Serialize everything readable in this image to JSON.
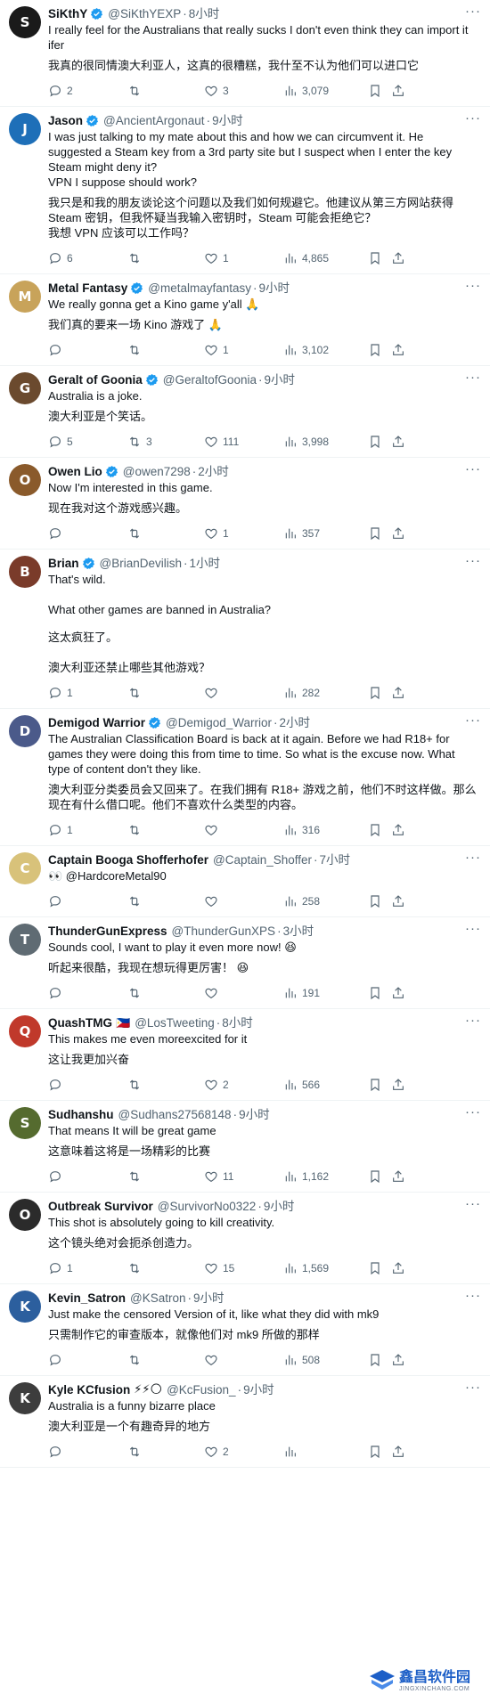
{
  "tweets": [
    {
      "name": "SiKthY",
      "verified": true,
      "handle": "@SiKthYEXP",
      "time": "8小时",
      "avatar_color": "#1a1a1a",
      "text": [
        "I really feel for the Australians that really sucks I don't even think they can import it ifer",
        "我真的很同情澳大利亚人，这真的很糟糕，我什至不认为他们可以进口它"
      ],
      "replies": "2",
      "retweets": "",
      "likes": "3",
      "views": "3,079"
    },
    {
      "name": "Jason",
      "verified": true,
      "handle": "@AncientArgonaut",
      "time": "9小时",
      "avatar_color": "#1e6fb8",
      "text": [
        "I was just talking to my mate about this and how we can circumvent it. He suggested a Steam key from a 3rd party site but I suspect when I enter the key Steam might deny it?\nVPN I suppose should work?",
        "我只是和我的朋友谈论这个问题以及我们如何规避它。他建议从第三方网站获得 Steam 密钥，但我怀疑当我输入密钥时，Steam 可能会拒绝它？\n我想 VPN 应该可以工作吗？"
      ],
      "replies": "6",
      "retweets": "",
      "likes": "1",
      "views": "4,865"
    },
    {
      "name": "Metal Fantasy",
      "verified": true,
      "handle": "@metalmayfantasy",
      "time": "9小时",
      "avatar_color": "#c8a35a",
      "text": [
        "We really gonna get a Kino game y'all 🙏",
        "我们真的要来一场 Kino 游戏了 🙏"
      ],
      "replies": "",
      "retweets": "",
      "likes": "1",
      "views": "3,102"
    },
    {
      "name": "Geralt of Goonia",
      "verified": true,
      "handle": "@GeraltofGoonia",
      "time": "9小时",
      "avatar_color": "#6b4a2e",
      "text": [
        "Australia is a joke.",
        "澳大利亚是个笑话。"
      ],
      "replies": "5",
      "retweets": "3",
      "likes": "111",
      "views": "3,998"
    },
    {
      "name": "Owen Lio",
      "verified": true,
      "handle": "@owen7298",
      "time": "2小时",
      "avatar_color": "#8a5a2b",
      "text": [
        "Now I'm interested in this game.",
        "现在我对这个游戏感兴趣。"
      ],
      "replies": "",
      "retweets": "",
      "likes": "1",
      "views": "357"
    },
    {
      "name": "Brian",
      "verified": true,
      "handle": "@BrianDevilish",
      "time": "1小时",
      "avatar_color": "#7a3b2a",
      "text": [
        "That's wild.\n\nWhat other games are banned in Australia?",
        "这太疯狂了。\n\n澳大利亚还禁止哪些其他游戏？"
      ],
      "replies": "1",
      "retweets": "",
      "likes": "",
      "views": "282"
    },
    {
      "name": "Demigod Warrior",
      "verified": true,
      "handle": "@Demigod_Warrior",
      "time": "2小时",
      "avatar_color": "#4b5a8a",
      "text": [
        "The Australian Classification Board is back at it again. Before we had R18+ for games they were doing this from time to time. So what is the excuse now. What type of content don't they like.",
        "澳大利亚分类委员会又回来了。在我们拥有 R18+ 游戏之前，他们不时这样做。那么现在有什么借口呢。他们不喜欢什么类型的内容。"
      ],
      "replies": "1",
      "retweets": "",
      "likes": "",
      "views": "316"
    },
    {
      "name": "Captain Booga Shofferhofer",
      "verified": false,
      "handle": "@Captain_Shoffer",
      "time": "7小时",
      "avatar_color": "#d8c27a",
      "text": [
        "👀 @HardcoreMetal90"
      ],
      "replies": "",
      "retweets": "",
      "likes": "",
      "views": "258"
    },
    {
      "name": "ThunderGunExpress",
      "verified": false,
      "handle": "@ThunderGunXPS",
      "time": "3小时",
      "avatar_color": "#5f6b73",
      "text": [
        "Sounds cool, I want to play it even more now! 😆",
        "听起来很酷，我现在想玩得更厉害！ 😆"
      ],
      "replies": "",
      "retweets": "",
      "likes": "",
      "views": "191"
    },
    {
      "name": "QuashTMG",
      "verified": false,
      "flag": "🇵🇭",
      "handle": "@LosTweeting",
      "time": "8小时",
      "avatar_color": "#c0392b",
      "text": [
        "This makes me even moreexcited for it",
        "这让我更加兴奋"
      ],
      "replies": "",
      "retweets": "",
      "likes": "2",
      "views": "566"
    },
    {
      "name": "Sudhanshu",
      "verified": false,
      "handle": "@Sudhans27568148",
      "time": "9小时",
      "avatar_color": "#556b2f",
      "text": [
        "That means It will be great game",
        "这意味着这将是一场精彩的比赛"
      ],
      "replies": "",
      "retweets": "",
      "likes": "11",
      "views": "1,162"
    },
    {
      "name": "Outbreak Survivor",
      "verified": false,
      "handle": "@SurvivorNo0322",
      "time": "9小时",
      "avatar_color": "#2b2b2b",
      "text": [
        "This shot is absolutely going to kill creativity.",
        "这个镜头绝对会扼杀创造力。"
      ],
      "replies": "1",
      "retweets": "",
      "likes": "15",
      "views": "1,569"
    },
    {
      "name": "Kevin_Satron",
      "verified": false,
      "handle": "@KSatron",
      "time": "9小时",
      "avatar_color": "#2c5f9e",
      "text": [
        "Just make the censored Version of it, like what they did with mk9",
        "只需制作它的审查版本，就像他们对 mk9 所做的那样"
      ],
      "replies": "",
      "retweets": "",
      "likes": "",
      "views": "508"
    },
    {
      "name": "Kyle KCfusion",
      "verified": false,
      "emojis": "⚡⚡🌕",
      "handle": "@KcFusion_",
      "time": "9小时",
      "avatar_color": "#3d3d3d",
      "text": [
        "Australia is a funny bizarre place",
        "澳大利亚是一个有趣奇异的地方"
      ],
      "replies": "",
      "retweets": "",
      "likes": "2",
      "views": ""
    }
  ],
  "watermark": {
    "cn": "鑫昌软件园",
    "en": "JINGXINCHANG.COM"
  }
}
